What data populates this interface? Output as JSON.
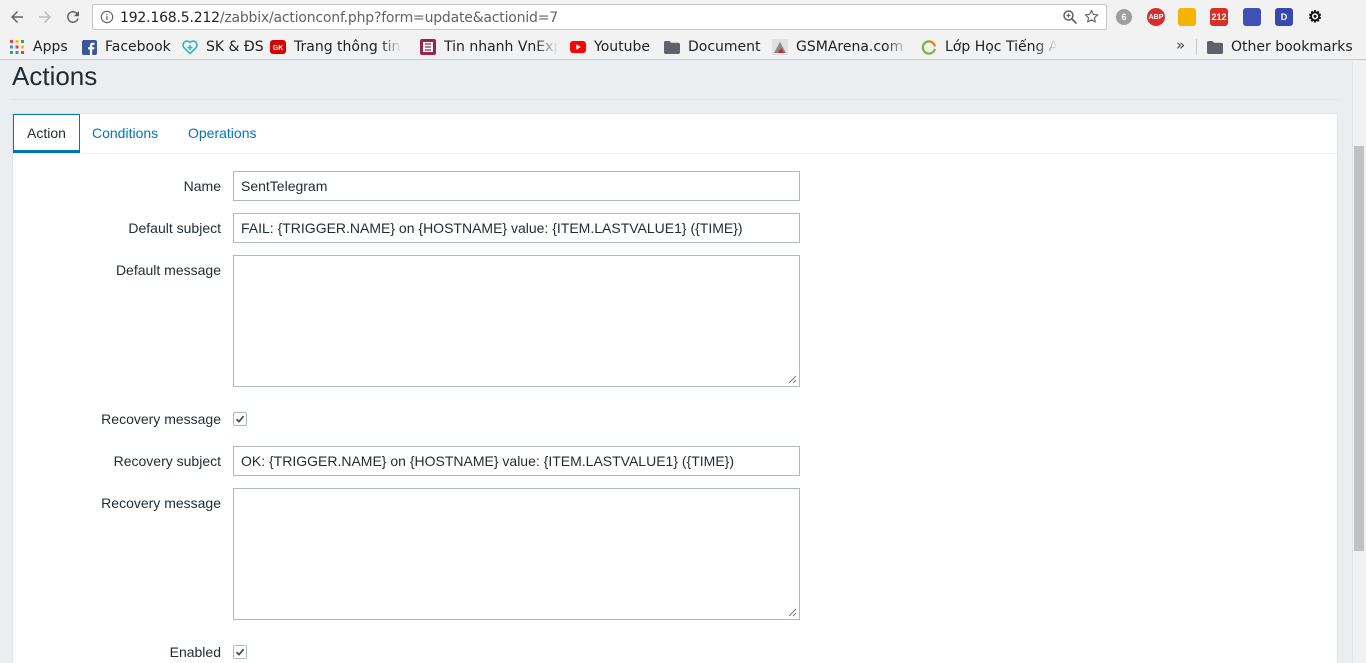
{
  "browser": {
    "url_host": "192.168.5.212",
    "url_path": "/zabbix/actionconf.php?form=update&actionid=7",
    "extensions": [
      {
        "name": "ghostery-icon",
        "color": "#9e9e9e",
        "label": "6"
      },
      {
        "name": "adblock-plus-icon",
        "color": "#d32f2f",
        "label": "ABP"
      },
      {
        "name": "extension-face-icon",
        "color": "#f4b400",
        "label": ""
      },
      {
        "name": "gmail-icon",
        "color": "#d93025",
        "label": "212"
      },
      {
        "name": "email-extension-icon",
        "color": "#3f51b5",
        "label": ""
      },
      {
        "name": "d-extension-icon",
        "color": "#3949ab",
        "label": "D"
      },
      {
        "name": "gnome-extension-icon",
        "color": "#111111",
        "label": ""
      }
    ]
  },
  "bookmarks": [
    {
      "name": "bookmark-apps",
      "label": "Apps",
      "icon": "apps-grid-icon",
      "color": "#e94235"
    },
    {
      "name": "bookmark-facebook",
      "label": "Facebook",
      "icon": "facebook-icon",
      "color": "#3b5998"
    },
    {
      "name": "bookmark-sk-ds",
      "label": "SK & ĐS",
      "icon": "heart-plus-icon",
      "color": "#2bbbad"
    },
    {
      "name": "bookmark-trang-thong-tin",
      "label": "Trang thông tin d",
      "icon": "news-icon",
      "color": "#d50000"
    },
    {
      "name": "bookmark-vnexpress",
      "label": "Tin nhanh VnExp",
      "icon": "vnexpress-icon",
      "color": "#9f224e"
    },
    {
      "name": "bookmark-youtube",
      "label": "Youtube",
      "icon": "youtube-icon",
      "color": "#ff0000"
    },
    {
      "name": "bookmark-document",
      "label": "Document",
      "icon": "folder-icon",
      "color": "#5f6368"
    },
    {
      "name": "bookmark-gsmarena",
      "label": "GSMArena.com -",
      "icon": "gsmarena-icon",
      "color": "#8a8a8a"
    },
    {
      "name": "bookmark-lop-hoc",
      "label": "Lớp Học Tiếng A",
      "icon": "refresh-circle-icon",
      "color": "#7cb342"
    }
  ],
  "other_bookmarks": "Other bookmarks",
  "page": {
    "title": "Actions",
    "tabs": [
      "Action",
      "Conditions",
      "Operations"
    ],
    "form": {
      "name_label": "Name",
      "name_value": "SentTelegram",
      "default_subject_label": "Default subject",
      "default_subject_value": "FAIL: {TRIGGER.NAME} on {HOSTNAME} value: {ITEM.LASTVALUE1} ({TIME})",
      "default_message_label": "Default message",
      "default_message_value": "",
      "recovery_message_checkbox_label": "Recovery message",
      "recovery_message_checked": true,
      "recovery_subject_label": "Recovery subject",
      "recovery_subject_value": "OK: {TRIGGER.NAME} on {HOSTNAME} value: {ITEM.LASTVALUE1} ({TIME})",
      "recovery_message_label": "Recovery message",
      "recovery_message_value": "",
      "enabled_label": "Enabled",
      "enabled_checked": true
    }
  }
}
